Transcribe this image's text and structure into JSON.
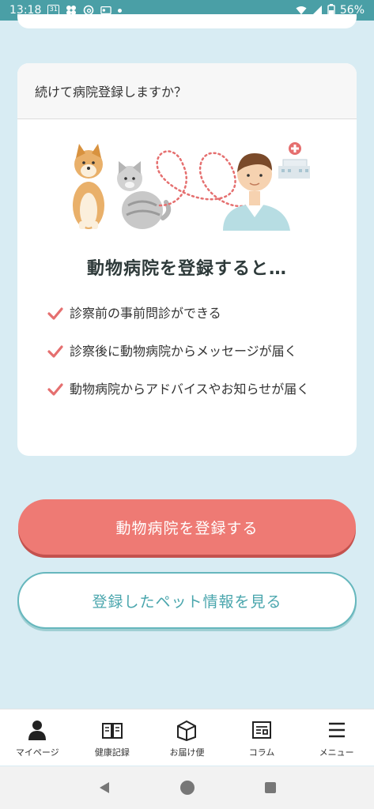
{
  "status_bar": {
    "time": "13:18",
    "calendar_day": "31",
    "battery": "56%"
  },
  "card": {
    "header": "続けて病院登録しますか？",
    "title": "動物病院を登録すると…",
    "benefits": [
      "診察前の事前問診ができる",
      "診察後に動物病院からメッセージが届く",
      "動物病院からアドバイスやお知らせが届く"
    ]
  },
  "buttons": {
    "register_hospital": "動物病院を登録する",
    "view_pet_info": "登録したペット情報を見る"
  },
  "bottom_nav": {
    "items": [
      {
        "label": "マイページ",
        "icon": "person-icon"
      },
      {
        "label": "健康記録",
        "icon": "book-icon"
      },
      {
        "label": "お届け便",
        "icon": "box-icon"
      },
      {
        "label": "コラム",
        "icon": "column-icon"
      },
      {
        "label": "メニュー",
        "icon": "menu-icon"
      }
    ]
  },
  "colors": {
    "primary": "#ee7a74",
    "accent": "#4aa6ad",
    "background": "#d8ecf3",
    "status_bar": "#4a9fa6"
  }
}
